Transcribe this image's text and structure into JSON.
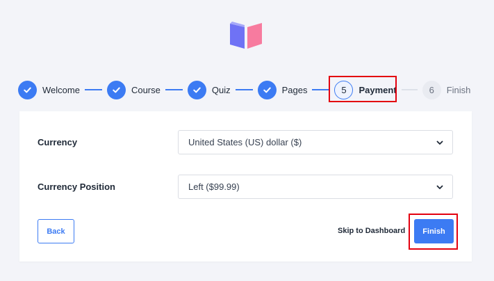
{
  "steps": [
    {
      "label": "Welcome",
      "state": "done"
    },
    {
      "label": "Course",
      "state": "done"
    },
    {
      "label": "Quiz",
      "state": "done"
    },
    {
      "label": "Pages",
      "state": "done"
    },
    {
      "label": "Payment",
      "state": "current",
      "number": "5"
    },
    {
      "label": "Finish",
      "state": "todo",
      "number": "6"
    }
  ],
  "form": {
    "currency_label": "Currency",
    "currency_value": "United States (US) dollar ($)",
    "position_label": "Currency Position",
    "position_value": "Left ($99.99)"
  },
  "actions": {
    "back": "Back",
    "skip": "Skip to Dashboard",
    "finish": "Finish"
  },
  "colors": {
    "accent": "#3c7bf3",
    "highlight": "#e3000f",
    "background": "#f3f4f9"
  }
}
